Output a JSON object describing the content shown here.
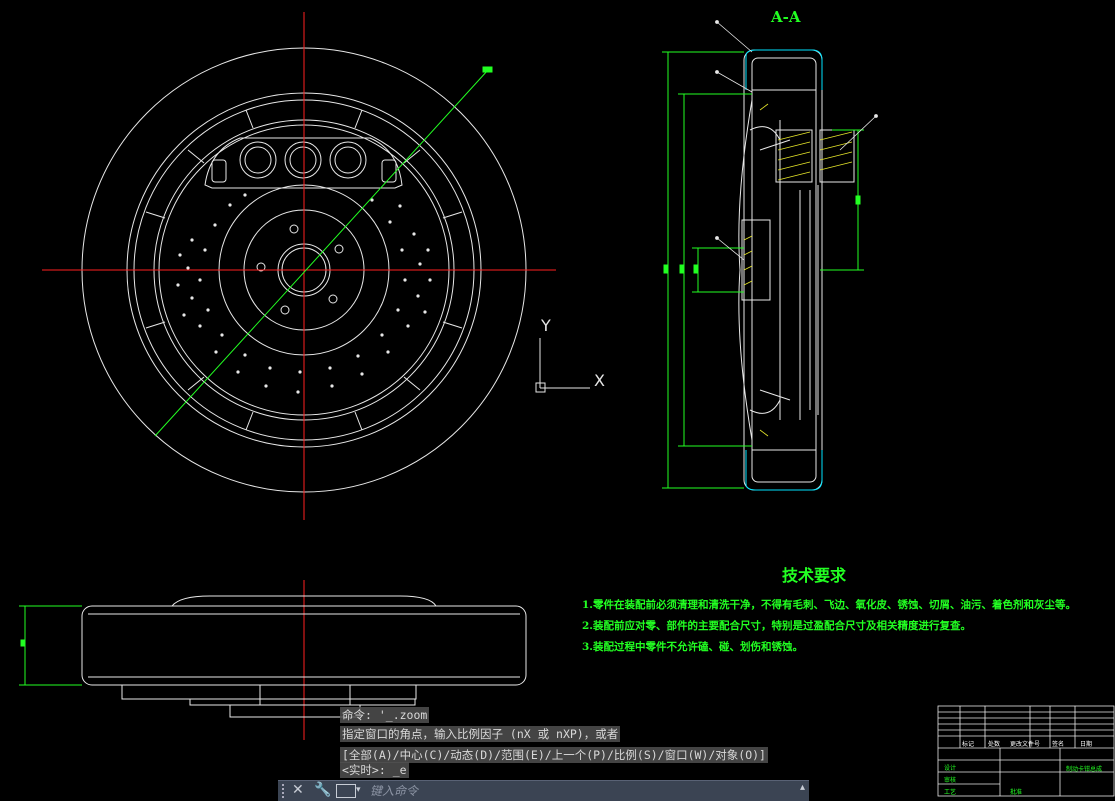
{
  "section_label": "A-A",
  "tech_requirements": {
    "title": "技术要求",
    "items": [
      "1.零件在装配前必须清理和清洗干净，不得有毛刺、飞边、氧化皮、锈蚀、切屑、油污、着色剂和灰尘等。",
      "2.装配前应对零、部件的主要配合尺寸，特别是过盈配合尺寸及相关精度进行复查。",
      "3.装配过程中零件不允许磕、碰、划伤和锈蚀。"
    ]
  },
  "ucs": {
    "x_label": "X",
    "y_label": "Y"
  },
  "command_history": [
    "命令: '_.zoom",
    "指定窗口的角点，输入比例因子 (nX 或 nXP)，或者",
    "[全部(A)/中心(C)/动态(D)/范围(E)/上一个(P)/比例(S)/窗口(W)/对象(O)]",
    "<实时>: _e"
  ],
  "command_input": {
    "placeholder": "键入命令"
  },
  "title_block": {
    "headers": [
      "标记",
      "处数",
      "更改文件号",
      "签名",
      "日期"
    ],
    "green_cells": [
      "设计",
      "审核",
      "工艺",
      "批准"
    ],
    "drawing_name": "制动卡钳总成"
  },
  "colors": {
    "background": "#000000",
    "geometry": "#ffffff",
    "centerline": "#ff2020",
    "section": "#00ffff",
    "dimension": "#22ff22",
    "hatch": "#ffff44"
  }
}
